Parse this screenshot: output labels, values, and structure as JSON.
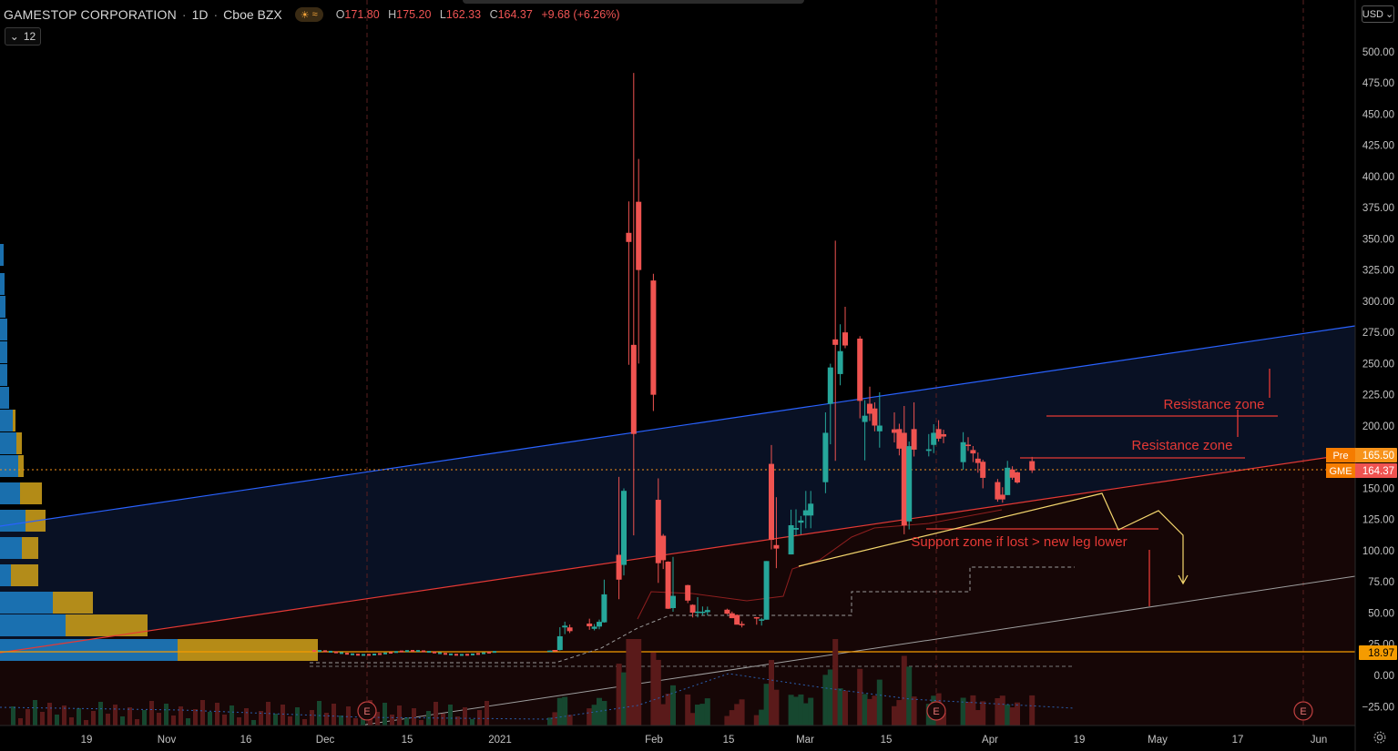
{
  "header": {
    "symbol": "GAMESTOP CORPORATION",
    "interval": "1D",
    "exchange": "Cboe BZX",
    "ohlc": {
      "o_label": "O",
      "o": "171.80",
      "h_label": "H",
      "h": "175.20",
      "l_label": "L",
      "l": "162.33",
      "c_label": "C",
      "c": "164.37",
      "change": "+9.68 (+6.26%)"
    },
    "session_icon": "sun-icon",
    "session_icon2": "wave-icon"
  },
  "indicator": {
    "label": "12",
    "chevron_icon": "chevron-down-icon"
  },
  "currency": {
    "label": "USD",
    "chevron_icon": "chevron-down-icon"
  },
  "settings_icon": "gear-icon",
  "colors": {
    "up": "#26a69a",
    "down": "#ef5350",
    "annotation": "#e53935",
    "blue_line": "#2962ff",
    "yellow": "#f5d76e",
    "pre": "#f7931a"
  },
  "chart_data": {
    "type": "candlestick",
    "y_axis": [
      "500.00",
      "475.00",
      "450.00",
      "425.00",
      "400.00",
      "375.00",
      "350.00",
      "325.00",
      "300.00",
      "275.00",
      "250.00",
      "225.00",
      "200.00",
      "175.00",
      "150.00",
      "125.00",
      "100.00",
      "75.00",
      "50.00",
      "25.00",
      "0.00",
      "−25.00"
    ],
    "ylim": [
      -25,
      500
    ],
    "x_labels": [
      "19",
      "Nov",
      "16",
      "Dec",
      "15",
      "2021",
      "Feb",
      "15",
      "Mar",
      "15",
      "Apr",
      "19",
      "May",
      "17",
      "Jun"
    ],
    "price_labels": {
      "pre_label": "Pre",
      "pre_value": "165.50",
      "symbol_label": "GME",
      "last_value": "164.37",
      "line_value": "18.97"
    },
    "annotations": [
      "Resistance zone",
      "Resistance zone",
      "Support zone if lost > new leg lower"
    ],
    "earnings_markers": [
      "E",
      "E",
      "E"
    ],
    "candles": [
      {
        "d": "2021-01-11",
        "o": 19.4,
        "h": 20.0,
        "l": 18.8,
        "c": 19.9
      },
      {
        "d": "2021-01-12",
        "o": 20.4,
        "h": 20.4,
        "l": 19.3,
        "c": 19.9
      },
      {
        "d": "2021-01-13",
        "o": 20.4,
        "h": 38.7,
        "l": 20.0,
        "c": 31.4
      },
      {
        "d": "2021-01-14",
        "o": 38.5,
        "h": 43.1,
        "l": 33.1,
        "c": 39.9
      },
      {
        "d": "2021-01-15",
        "o": 38.5,
        "h": 40.8,
        "l": 34.0,
        "c": 35.5
      },
      {
        "d": "2021-01-19",
        "o": 41.6,
        "h": 45.5,
        "l": 36.6,
        "c": 39.4
      },
      {
        "d": "2021-01-20",
        "o": 37.4,
        "h": 41.2,
        "l": 36.1,
        "c": 39.1
      },
      {
        "d": "2021-01-21",
        "o": 39.2,
        "h": 44.8,
        "l": 37.0,
        "c": 43.0
      },
      {
        "d": "2021-01-22",
        "o": 42.6,
        "h": 76.8,
        "l": 42.3,
        "c": 65.0
      },
      {
        "d": "2021-01-25",
        "o": 96.7,
        "h": 159.2,
        "l": 61.1,
        "c": 76.8
      },
      {
        "d": "2021-01-26",
        "o": 88.6,
        "h": 150.0,
        "l": 80.2,
        "c": 147.98
      },
      {
        "d": "2021-01-27",
        "o": 354.8,
        "h": 380.0,
        "l": 249.0,
        "c": 347.5
      },
      {
        "d": "2021-01-28",
        "o": 265.0,
        "h": 483.0,
        "l": 112.3,
        "c": 193.6
      },
      {
        "d": "2021-01-29",
        "o": 379.7,
        "h": 413.98,
        "l": 250.0,
        "c": 325.0
      },
      {
        "d": "2021-02-01",
        "o": 316.6,
        "h": 322.0,
        "l": 212.0,
        "c": 225.0
      },
      {
        "d": "2021-02-02",
        "o": 140.8,
        "h": 158.0,
        "l": 74.2,
        "c": 90.0
      },
      {
        "d": "2021-02-03",
        "o": 112.0,
        "h": 113.4,
        "l": 85.3,
        "c": 92.4
      },
      {
        "d": "2021-02-04",
        "o": 91.2,
        "h": 91.5,
        "l": 53.3,
        "c": 53.5
      },
      {
        "d": "2021-02-05",
        "o": 54.0,
        "h": 95.0,
        "l": 51.1,
        "c": 63.8
      },
      {
        "d": "2021-02-08",
        "o": 72.4,
        "h": 72.7,
        "l": 58.0,
        "c": 60.0
      },
      {
        "d": "2021-02-09",
        "o": 56.6,
        "h": 57.0,
        "l": 46.5,
        "c": 50.3
      },
      {
        "d": "2021-02-10",
        "o": 50.8,
        "h": 62.8,
        "l": 46.5,
        "c": 51.2
      },
      {
        "d": "2021-02-11",
        "o": 50.0,
        "h": 55.3,
        "l": 48.2,
        "c": 51.1
      },
      {
        "d": "2021-02-12",
        "o": 50.75,
        "h": 55.2,
        "l": 48.1,
        "c": 52.4
      },
      {
        "d": "2021-02-16",
        "o": 52.7,
        "h": 53.5,
        "l": 49.0,
        "c": 49.5
      },
      {
        "d": "2021-02-17",
        "o": 49.8,
        "h": 51.2,
        "l": 45.9,
        "c": 45.9
      },
      {
        "d": "2021-02-18",
        "o": 48.5,
        "h": 48.9,
        "l": 42.3,
        "c": 40.7
      },
      {
        "d": "2021-02-19",
        "o": 41.3,
        "h": 43.4,
        "l": 38.5,
        "c": 40.6
      },
      {
        "d": "2021-02-22",
        "o": 46.7,
        "h": 46.9,
        "l": 40.7,
        "c": 46.0
      },
      {
        "d": "2021-02-23",
        "o": 44.9,
        "h": 46.2,
        "l": 40.0,
        "c": 44.97
      },
      {
        "d": "2021-02-24",
        "o": 44.7,
        "h": 91.7,
        "l": 44.7,
        "c": 91.7
      },
      {
        "d": "2021-02-25",
        "o": 169.6,
        "h": 184.7,
        "l": 101.1,
        "c": 108.7
      },
      {
        "d": "2021-02-26",
        "o": 104.5,
        "h": 142.9,
        "l": 86.0,
        "c": 101.7
      },
      {
        "d": "2021-03-01",
        "o": 97.0,
        "h": 132.9,
        "l": 97.0,
        "c": 120.4
      },
      {
        "d": "2021-03-02",
        "o": 116.9,
        "h": 133.2,
        "l": 112.2,
        "c": 118.2
      },
      {
        "d": "2021-03-03",
        "o": 122.5,
        "h": 127.8,
        "l": 113.1,
        "c": 124.2
      },
      {
        "d": "2021-03-04",
        "o": 128.2,
        "h": 147.9,
        "l": 118.0,
        "c": 132.4
      },
      {
        "d": "2021-03-05",
        "o": 128.2,
        "h": 147.9,
        "l": 118.0,
        "c": 137.7
      },
      {
        "d": "2021-03-08",
        "o": 154.9,
        "h": 210.9,
        "l": 146.1,
        "c": 194.5
      },
      {
        "d": "2021-03-09",
        "o": 217.7,
        "h": 249.9,
        "l": 185.3,
        "c": 246.9
      },
      {
        "d": "2021-03-10",
        "o": 269.4,
        "h": 348.5,
        "l": 172.0,
        "c": 265.0
      },
      {
        "d": "2021-03-11",
        "o": 241.6,
        "h": 281.5,
        "l": 232.6,
        "c": 260.0
      },
      {
        "d": "2021-03-12",
        "o": 275.0,
        "h": 295.5,
        "l": 262.3,
        "c": 264.5
      },
      {
        "d": "2021-03-15",
        "o": 270.0,
        "h": 272.0,
        "l": 206.1,
        "c": 220.1
      },
      {
        "d": "2021-03-16",
        "o": 203.2,
        "h": 220.7,
        "l": 172.4,
        "c": 208.2
      },
      {
        "d": "2021-03-17",
        "o": 217.8,
        "h": 231.5,
        "l": 204.0,
        "c": 209.8
      },
      {
        "d": "2021-03-18",
        "o": 214.0,
        "h": 218.9,
        "l": 195.7,
        "c": 200.3
      },
      {
        "d": "2021-03-19",
        "o": 195.7,
        "h": 227.0,
        "l": 182.6,
        "c": 200.3
      },
      {
        "d": "2021-03-22",
        "o": 197.3,
        "h": 210.9,
        "l": 186.8,
        "c": 194.5
      },
      {
        "d": "2021-03-23",
        "o": 197.5,
        "h": 201.8,
        "l": 176.4,
        "c": 181.8
      },
      {
        "d": "2021-03-24",
        "o": 194.5,
        "h": 216.0,
        "l": 113.2,
        "c": 120.3
      },
      {
        "d": "2021-03-25",
        "o": 123.5,
        "h": 187.5,
        "l": 117.1,
        "c": 183.8
      },
      {
        "d": "2021-03-26",
        "o": 197.5,
        "h": 218.9,
        "l": 175.5,
        "c": 181.0
      },
      {
        "d": "2021-03-29",
        "o": 180.0,
        "h": 193.5,
        "l": 175.6,
        "c": 181.3
      },
      {
        "d": "2021-03-30",
        "o": 184.8,
        "h": 201.4,
        "l": 178.2,
        "c": 194.5
      },
      {
        "d": "2021-03-31",
        "o": 197.5,
        "h": 204.6,
        "l": 187.5,
        "c": 189.8
      },
      {
        "d": "2021-04-01",
        "o": 193.4,
        "h": 196.9,
        "l": 186.2,
        "c": 191.5
      },
      {
        "d": "2021-04-05",
        "o": 171.0,
        "h": 195.0,
        "l": 165.0,
        "c": 186.95
      },
      {
        "d": "2021-04-06",
        "o": 185.0,
        "h": 191.0,
        "l": 180.0,
        "c": 184.5
      },
      {
        "d": "2021-04-07",
        "o": 180.7,
        "h": 183.9,
        "l": 171.0,
        "c": 177.97
      },
      {
        "d": "2021-04-08",
        "o": 173.8,
        "h": 178.8,
        "l": 162.5,
        "c": 170.3
      },
      {
        "d": "2021-04-09",
        "o": 171.3,
        "h": 172.9,
        "l": 150.0,
        "c": 158.4
      },
      {
        "d": "2021-04-12",
        "o": 155.0,
        "h": 157.5,
        "l": 139.3,
        "c": 141.1
      },
      {
        "d": "2021-04-13",
        "o": 144.9,
        "h": 150.9,
        "l": 138.5,
        "c": 141.1
      },
      {
        "d": "2021-04-14",
        "o": 144.6,
        "h": 172.0,
        "l": 144.6,
        "c": 166.5
      },
      {
        "d": "2021-04-15",
        "o": 165.1,
        "h": 167.7,
        "l": 156.9,
        "c": 158.5
      },
      {
        "d": "2021-04-16",
        "o": 162.8,
        "h": 163.5,
        "l": 153.8,
        "c": 154.7
      },
      {
        "d": "2021-04-19",
        "o": 171.8,
        "h": 175.2,
        "l": 162.33,
        "c": 164.37
      }
    ]
  }
}
